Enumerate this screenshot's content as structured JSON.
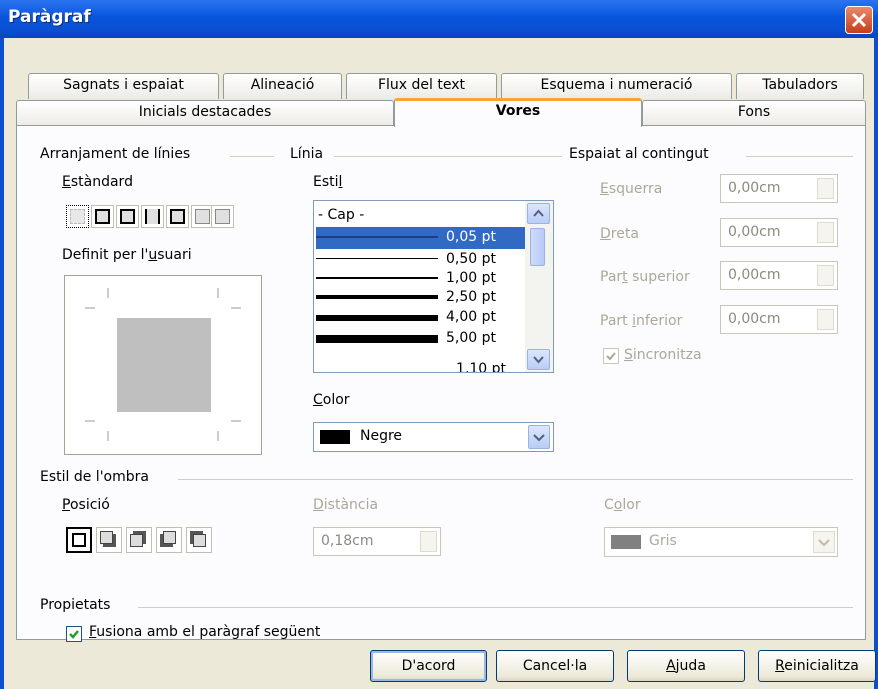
{
  "window": {
    "title": "Paràgraf"
  },
  "tabs_row1": [
    "Sagnats i espaiat",
    "Alineació",
    "Flux del text",
    "Esquema i numeració",
    "Tabuladors"
  ],
  "tabs_row2": [
    "Inicials destacades",
    "Vores",
    "Fons"
  ],
  "line_arrangement": {
    "header": "Arranjament de línies",
    "default_label": "Estàndard",
    "user_defined_label": "Definit per l'usuari"
  },
  "line": {
    "header": "Línia",
    "style_label": "Estil",
    "styles": [
      {
        "label": "- Cap -"
      },
      {
        "label": "0,05 pt",
        "selected": true
      },
      {
        "label": "0,50 pt"
      },
      {
        "label": "1,00 pt"
      },
      {
        "label": "2,50 pt"
      },
      {
        "label": "4,00 pt"
      },
      {
        "label": "5,00 pt"
      },
      {
        "label": "1,10 pt"
      }
    ],
    "color_label": "Color",
    "color_value": "Negre",
    "color_swatch": "#000000"
  },
  "spacing": {
    "header": "Espaiat al contingut",
    "left_label": "Esquerra",
    "left_value": "0,00cm",
    "right_label": "Dreta",
    "right_value": "0,00cm",
    "top_label": "Part superior",
    "top_value": "0,00cm",
    "bottom_label": "Part inferior",
    "bottom_value": "0,00cm",
    "sync_label": "Sincronitza",
    "sync_checked": true
  },
  "shadow": {
    "header": "Estil de l'ombra",
    "position_label": "Posició",
    "distance_label": "Distància",
    "distance_value": "0,18cm",
    "color_label": "Color",
    "color_value": "Gris",
    "color_swatch": "#808080"
  },
  "properties": {
    "header": "Propietats",
    "merge_label": "Fusiona amb el paràgraf següent",
    "merge_checked": true
  },
  "buttons": {
    "ok": "D'acord",
    "cancel": "Cancel·la",
    "help": "Ajuda",
    "reset": "Reinicialitza"
  }
}
